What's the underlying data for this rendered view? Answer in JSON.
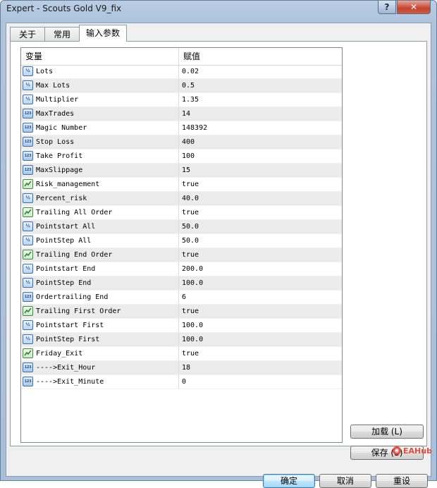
{
  "window": {
    "title": "Expert - Scouts Gold V9_fix",
    "help_label": "?",
    "close_label": "✕"
  },
  "tabs": [
    {
      "label": "关于"
    },
    {
      "label": "常用"
    },
    {
      "label": "输入参数"
    }
  ],
  "table": {
    "headers": {
      "variable": "变量",
      "value": "赋值"
    },
    "rows": [
      {
        "icon": "double",
        "name": "Lots",
        "value": "0.02"
      },
      {
        "icon": "double",
        "name": "Max Lots",
        "value": "0.5"
      },
      {
        "icon": "double",
        "name": "Multiplier",
        "value": "1.35"
      },
      {
        "icon": "int",
        "name": "MaxTrades",
        "value": "14"
      },
      {
        "icon": "int",
        "name": "Magic Number",
        "value": "148392"
      },
      {
        "icon": "int",
        "name": "Stop Loss",
        "value": "400"
      },
      {
        "icon": "int",
        "name": "Take Profit",
        "value": "100"
      },
      {
        "icon": "int",
        "name": "MaxSlippage",
        "value": "15"
      },
      {
        "icon": "bool",
        "name": "Risk_management",
        "value": "true"
      },
      {
        "icon": "double",
        "name": "Percent_risk",
        "value": "40.0"
      },
      {
        "icon": "bool",
        "name": "Trailing All Order",
        "value": "true"
      },
      {
        "icon": "double",
        "name": "Pointstart All",
        "value": "50.0"
      },
      {
        "icon": "double",
        "name": "PointStep All",
        "value": "50.0"
      },
      {
        "icon": "bool",
        "name": "Trailing End Order",
        "value": "true"
      },
      {
        "icon": "double",
        "name": "Pointstart End",
        "value": "200.0"
      },
      {
        "icon": "double",
        "name": "PointStep End",
        "value": "100.0"
      },
      {
        "icon": "int",
        "name": "Ordertrailing End",
        "value": "6"
      },
      {
        "icon": "bool",
        "name": "Trailing First Order",
        "value": "true"
      },
      {
        "icon": "double",
        "name": "Pointstart First",
        "value": "100.0"
      },
      {
        "icon": "double",
        "name": "PointStep First",
        "value": "100.0"
      },
      {
        "icon": "bool",
        "name": "Friday_Exit",
        "value": "true"
      },
      {
        "icon": "int",
        "name": "---->Exit_Hour",
        "value": "18"
      },
      {
        "icon": "int",
        "name": "---->Exit_Minute",
        "value": "0"
      }
    ]
  },
  "icon_labels": {
    "double": "½",
    "int": "123"
  },
  "buttons": {
    "load": "加载 (L)",
    "save": "保存 (S)",
    "ok": "确定",
    "cancel": "取消",
    "reset": "重设"
  },
  "watermark": {
    "text": "EAHub"
  }
}
